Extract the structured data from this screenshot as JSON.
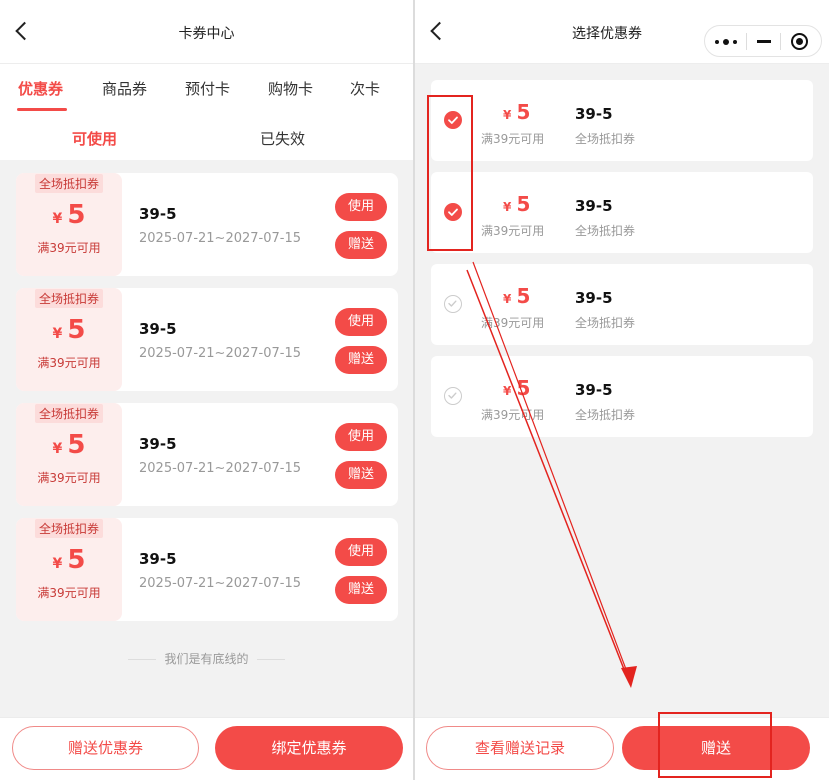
{
  "left": {
    "title": "卡券中心",
    "tabs": [
      "优惠券",
      "商品券",
      "预付卡",
      "购物卡",
      "次卡"
    ],
    "subtabs": [
      "可使用",
      "已失效"
    ],
    "coupons": [
      {
        "tag": "全场抵扣券",
        "yen": "¥",
        "amount": "5",
        "condition": "满39元可用",
        "name": "39-5",
        "date": "2025-07-21~2027-07-15",
        "use_label": "使用",
        "gift_label": "赠送"
      },
      {
        "tag": "全场抵扣券",
        "yen": "¥",
        "amount": "5",
        "condition": "满39元可用",
        "name": "39-5",
        "date": "2025-07-21~2027-07-15",
        "use_label": "使用",
        "gift_label": "赠送"
      },
      {
        "tag": "全场抵扣券",
        "yen": "¥",
        "amount": "5",
        "condition": "满39元可用",
        "name": "39-5",
        "date": "2025-07-21~2027-07-15",
        "use_label": "使用",
        "gift_label": "赠送"
      },
      {
        "tag": "全场抵扣券",
        "yen": "¥",
        "amount": "5",
        "condition": "满39元可用",
        "name": "39-5",
        "date": "2025-07-21~2027-07-15",
        "use_label": "使用",
        "gift_label": "赠送"
      }
    ],
    "footer_note": "我们是有底线的",
    "gift_coupon_button": "赠送优惠券",
    "bind_coupon_button": "绑定优惠券"
  },
  "right": {
    "title": "选择优惠券",
    "items": [
      {
        "checked": true,
        "yen": "¥",
        "amount": "5",
        "condition": "满39元可用",
        "name": "39-5",
        "desc": "全场抵扣券"
      },
      {
        "checked": true,
        "yen": "¥",
        "amount": "5",
        "condition": "满39元可用",
        "name": "39-5",
        "desc": "全场抵扣券"
      },
      {
        "checked": false,
        "yen": "¥",
        "amount": "5",
        "condition": "满39元可用",
        "name": "39-5",
        "desc": "全场抵扣券"
      },
      {
        "checked": false,
        "yen": "¥",
        "amount": "5",
        "condition": "满39元可用",
        "name": "39-5",
        "desc": "全场抵扣券"
      }
    ],
    "view_records_button": "查看赠送记录",
    "gift_button": "赠送"
  },
  "colors": {
    "accent": "#f34b48",
    "annotation": "#e3241f"
  }
}
